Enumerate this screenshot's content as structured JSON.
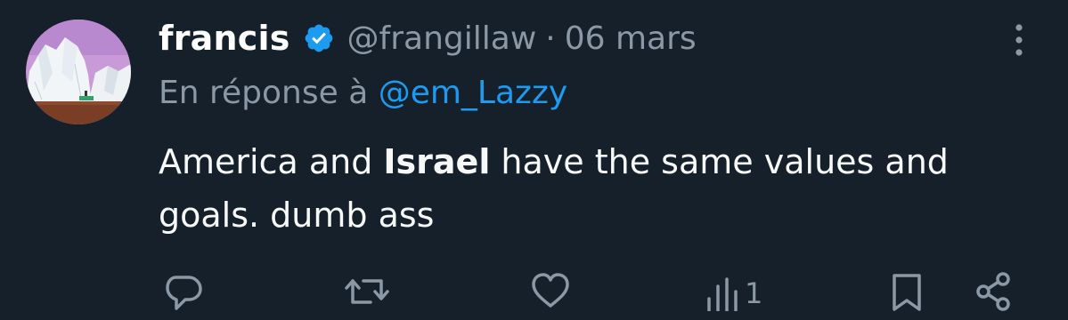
{
  "tweet": {
    "author_name": "francis",
    "handle": "@frangillaw",
    "separator": "·",
    "date": "06 mars",
    "verified": true,
    "reply_prefix": "En réponse à",
    "reply_to": "@em_Lazzy",
    "text_part1": "America and ",
    "text_bold": "Israel",
    "text_part2": " have the same values and goals. dumb ass"
  },
  "actions": {
    "views_count": "1"
  },
  "colors": {
    "background": "#15202b",
    "text": "#f7f9f9",
    "muted": "#8b98a5",
    "accent": "#1d9bf0"
  },
  "icons": [
    "verified-badge-icon",
    "more-icon",
    "reply-icon",
    "retweet-icon",
    "like-icon",
    "views-icon",
    "bookmark-icon",
    "share-icon"
  ]
}
